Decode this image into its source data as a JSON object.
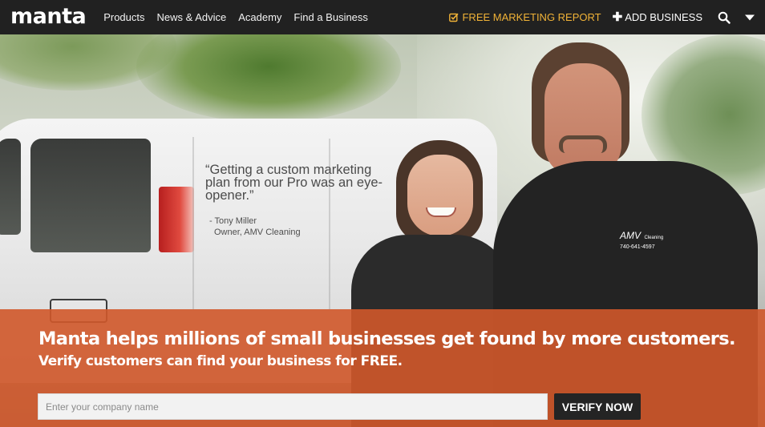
{
  "header": {
    "logo": "manta",
    "nav": [
      "Products",
      "News & Advice",
      "Academy",
      "Find a Business"
    ],
    "promo_label": "FREE MARKETING REPORT",
    "add_business_label": "ADD BUSINESS",
    "icons": {
      "promo": "check-square-icon",
      "add": "plus-icon",
      "search": "search-icon",
      "menu": "caret-down-icon"
    },
    "colors": {
      "bar": "#212121",
      "promo": "#f0b237"
    }
  },
  "hero": {
    "quote": "“Getting a custom marketing plan from our Pro was an eye-opener.”",
    "author_name": "- Tony Miller",
    "author_title": "Owner, AMV Cleaning",
    "shirt_logo": "AMV",
    "shirt_logo_sub": "Cleaning",
    "shirt_phone": "740-641-4597"
  },
  "cta": {
    "headline": "Manta helps millions of small businesses get found by more customers.",
    "subline": "Verify customers can find your business for FREE.",
    "input_placeholder": "Enter your company name",
    "button_label": "VERIFY NOW",
    "colors": {
      "band": "#d0582a",
      "button": "#242424"
    }
  }
}
